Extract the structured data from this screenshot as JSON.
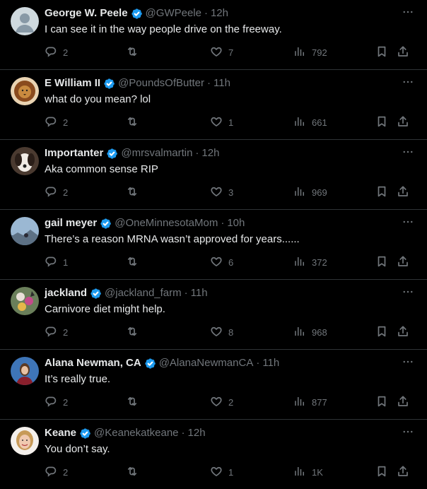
{
  "colors": {
    "background": "#000000",
    "text": "#e7e9ea",
    "muted": "#71767b",
    "verified": "#1d9bf0",
    "divider": "#2f3336"
  },
  "tweets": [
    {
      "name": "George W. Peele",
      "verified": true,
      "handle": "@GWPeele",
      "time": "12h",
      "text": "I can see it in the way people drive on the freeway.",
      "replies": "2",
      "retweets": "",
      "likes": "7",
      "views": "792",
      "avatar": "default-avatar"
    },
    {
      "name": "E William II",
      "verified": true,
      "handle": "@PoundsOfButter",
      "time": "11h",
      "text": "what do you mean? lol",
      "replies": "2",
      "retweets": "",
      "likes": "1",
      "views": "661",
      "avatar": "lion-avatar"
    },
    {
      "name": "Importanter",
      "verified": true,
      "handle": "@mrsvalmartin",
      "time": "12h",
      "text": "Aka common sense RIP",
      "replies": "2",
      "retweets": "",
      "likes": "3",
      "views": "969",
      "avatar": "dog-avatar"
    },
    {
      "name": "gail meyer",
      "verified": true,
      "handle": "@OneMinnesotaMom",
      "time": "10h",
      "text": "There’s a reason MRNA wasn’t approved for years......",
      "replies": "1",
      "retweets": "",
      "likes": "6",
      "views": "372",
      "avatar": "landscape-avatar"
    },
    {
      "name": "jackland",
      "verified": true,
      "handle": "@jackland_farm",
      "time": "11h",
      "text": "Carnivore diet might help.",
      "replies": "2",
      "retweets": "",
      "likes": "8",
      "views": "968",
      "avatar": "flower-avatar"
    },
    {
      "name": "Alana Newman, CA",
      "verified": true,
      "handle": "@AlanaNewmanCA",
      "time": "11h",
      "text": "It’s really true.",
      "replies": "2",
      "retweets": "",
      "likes": "2",
      "views": "877",
      "avatar": "woman-avatar"
    },
    {
      "name": "Keane",
      "verified": true,
      "handle": "@Keanekatkeane",
      "time": "12h",
      "text": "You don’t say.",
      "replies": "2",
      "retweets": "",
      "likes": "1",
      "views": "1K",
      "avatar": "woman-blonde-avatar"
    }
  ],
  "separator": "·"
}
